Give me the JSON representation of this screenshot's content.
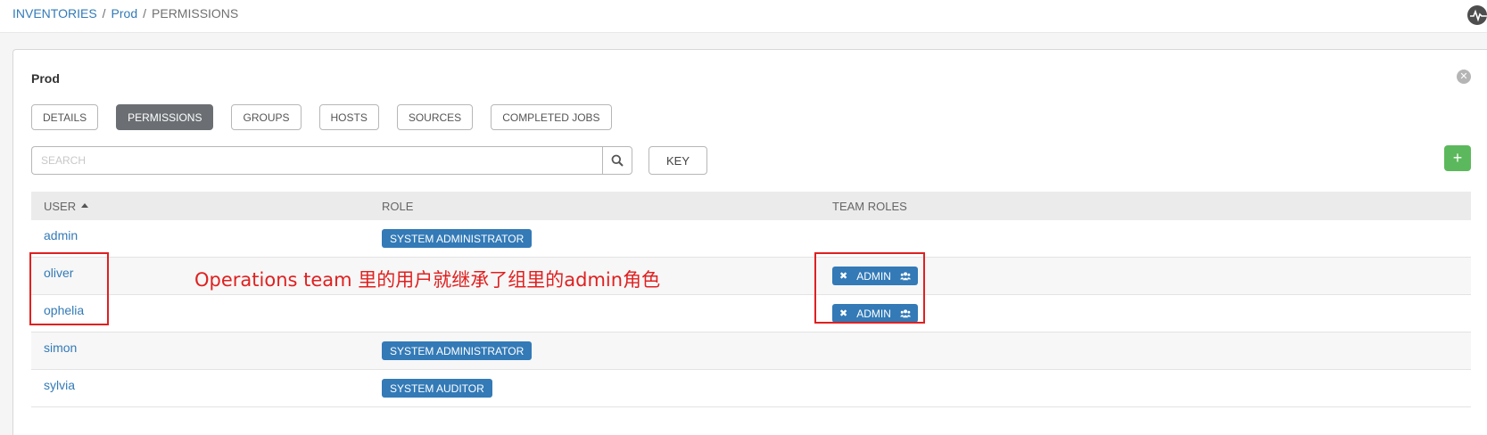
{
  "breadcrumb": {
    "inventories": "INVENTORIES",
    "sep1": "/",
    "prod": "Prod",
    "sep2": "/",
    "current": "PERMISSIONS"
  },
  "panel": {
    "title": "Prod",
    "close_label": "✕"
  },
  "tabs": [
    {
      "label": "DETAILS",
      "active": false
    },
    {
      "label": "PERMISSIONS",
      "active": true
    },
    {
      "label": "GROUPS",
      "active": false
    },
    {
      "label": "HOSTS",
      "active": false
    },
    {
      "label": "SOURCES",
      "active": false
    },
    {
      "label": "COMPLETED JOBS",
      "active": false
    }
  ],
  "search": {
    "placeholder": "SEARCH",
    "value": ""
  },
  "key_button": "KEY",
  "add_button": "+",
  "table": {
    "columns": {
      "user": "USER",
      "role": "ROLE",
      "team_roles": "TEAM ROLES"
    },
    "sort": {
      "column": "user",
      "direction": "ascending"
    },
    "rows": [
      {
        "user": "admin",
        "role": "SYSTEM ADMINISTRATOR",
        "team_role": ""
      },
      {
        "user": "oliver",
        "role": "",
        "team_role": "ADMIN"
      },
      {
        "user": "ophelia",
        "role": "",
        "team_role": "ADMIN"
      },
      {
        "user": "simon",
        "role": "SYSTEM ADMINISTRATOR",
        "team_role": ""
      },
      {
        "user": "sylvia",
        "role": "SYSTEM AUDITOR",
        "team_role": ""
      }
    ]
  },
  "annotation": {
    "text": "Operations team 里的用户就继承了组里的admin角色",
    "color": "#e02020"
  },
  "colors": {
    "link": "#337ab7",
    "badge": "#337ab7",
    "active_tab": "#6b6f73",
    "add": "#5cb85c"
  }
}
